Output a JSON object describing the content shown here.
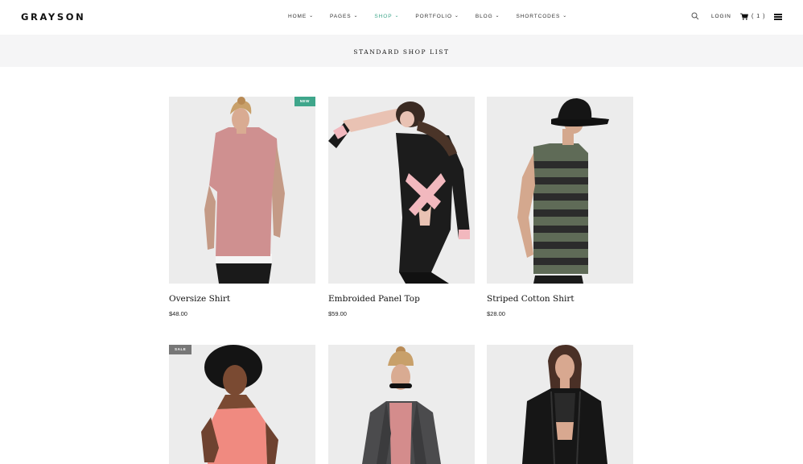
{
  "brand": "GRAYSON",
  "nav": [
    {
      "label": "HOME"
    },
    {
      "label": "PAGES"
    },
    {
      "label": "SHOP"
    },
    {
      "label": "PORTFOLIO"
    },
    {
      "label": "BLOG"
    },
    {
      "label": "SHORTCODES"
    }
  ],
  "nav_active": "SHOP",
  "header": {
    "login": "LOGIN",
    "cart_count": "( 1 )"
  },
  "page_title": "STANDARD SHOP LIST",
  "colors": {
    "accent": "#3fa68b",
    "band": "#f5f5f6"
  },
  "products": [
    {
      "name": "Oversize Shirt",
      "price": "$48.00",
      "badge": "NEW"
    },
    {
      "name": "Embroided Panel Top",
      "price": "$59.00",
      "badge": ""
    },
    {
      "name": "Striped Cotton Shirt",
      "price": "$28.00",
      "badge": ""
    },
    {
      "name": "",
      "price": "",
      "badge": "SALE"
    },
    {
      "name": "",
      "price": "",
      "badge": ""
    },
    {
      "name": "",
      "price": "",
      "badge": ""
    }
  ]
}
